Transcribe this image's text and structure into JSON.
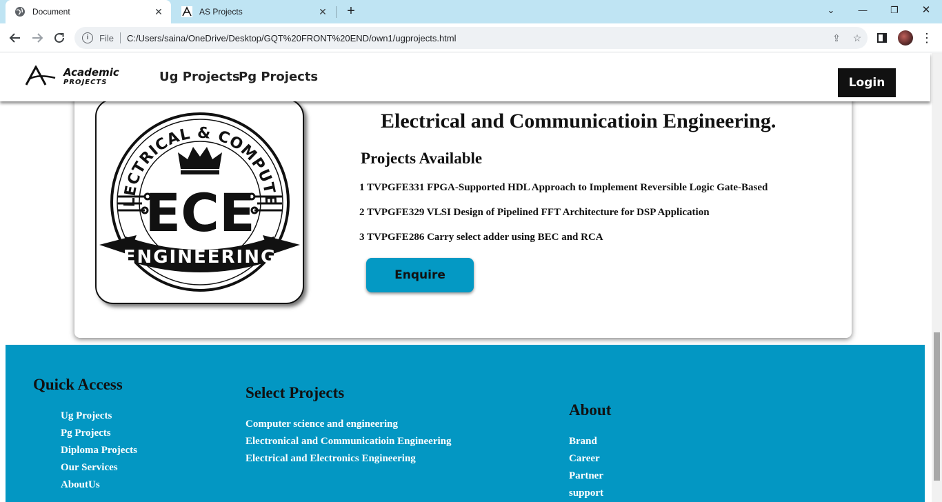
{
  "browser": {
    "tabs": [
      {
        "title": "Document",
        "active": true
      },
      {
        "title": "AS Projects",
        "active": false
      }
    ],
    "new_tab": "+",
    "address": {
      "scheme": "File",
      "url": "C:/Users/saina/OneDrive/Desktop/GQT%20FRONT%20END/own1/ugprojects.html"
    },
    "icons": {
      "back": "back-arrow-icon",
      "forward": "forward-arrow-icon",
      "reload": "reload-icon",
      "info": "info-icon",
      "share": "share-icon",
      "bookmark": "star-icon",
      "sidepanel": "side-panel-icon",
      "menu": "kebab-menu-icon"
    }
  },
  "site": {
    "logo": {
      "word1": "Academic",
      "word2": "PROJECTS",
      "letter": "A"
    },
    "nav": [
      "Ug Projects",
      "Pg Projects"
    ],
    "login_label": "Login"
  },
  "card": {
    "logo_text": {
      "top": "ELECTRICAL & COMPUTER",
      "center": "ECE",
      "banner": "ENGINEERING"
    },
    "title": "Electrical and Communicatioin Engineering.",
    "projects_heading": "Projects Available",
    "projects": [
      "1 TVPGFE331 FPGA-Supported HDL Approach to Implement Reversible Logic Gate-Based",
      "2 TVPGFE329 VLSI Design of Pipelined FFT Architecture for DSP Application",
      "3 TVPGFE286 Carry select adder using BEC and RCA"
    ],
    "enquire_label": "Enquire"
  },
  "footer": {
    "quick_access": {
      "heading": "Quick Access",
      "links": [
        "Ug Projects",
        "Pg Projects",
        "Diploma Projects",
        "Our Services",
        "AboutUs"
      ]
    },
    "select_projects": {
      "heading": "Select Projects",
      "links": [
        "Computer science and engineering",
        "Electronical and Communicatioin Engineering",
        "Electrical and Electronics Engineering"
      ]
    },
    "about": {
      "heading": "About",
      "links": [
        "Brand",
        "Career",
        "Partner",
        "support"
      ]
    }
  },
  "colors": {
    "tabbar": "#bfe4f3",
    "accent": "#0397c3",
    "login_bg": "#111111"
  }
}
